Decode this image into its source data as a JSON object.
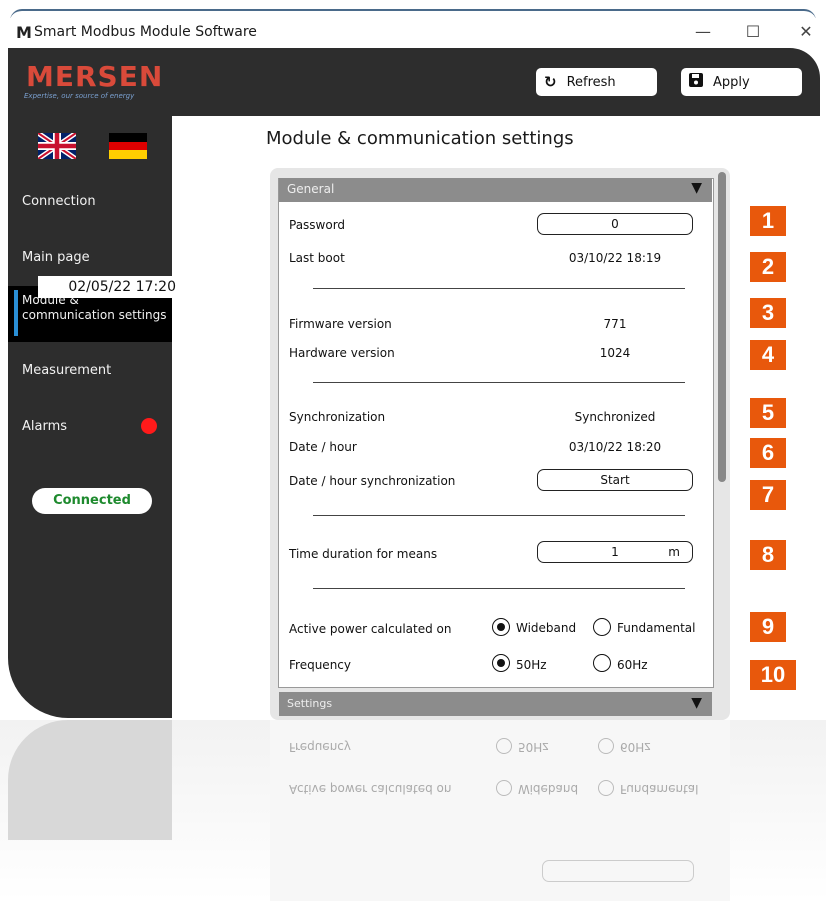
{
  "window": {
    "title": "Smart Modbus Module Software"
  },
  "brand": {
    "logo": "MERSEN",
    "tagline": "Expertise, our source of energy"
  },
  "toolbar": {
    "refresh_label": "Refresh",
    "apply_label": "Apply"
  },
  "sidebar": {
    "items": [
      {
        "label": "Connection"
      },
      {
        "label": "Main page"
      },
      {
        "label": "Module & communication settings"
      },
      {
        "label": "Measurement"
      },
      {
        "label": "Alarms"
      }
    ],
    "tooltip": "02/05/22 17:20",
    "status": "Connected",
    "alarm_color": "#ff1a1a"
  },
  "main": {
    "title": "Module & communication settings",
    "section_general": "General",
    "section_settings": "Settings",
    "rows": {
      "password_label": "Password",
      "password_value": "0",
      "last_boot_label": "Last boot",
      "last_boot_value": "03/10/22 18:19",
      "firmware_label": "Firmware version",
      "firmware_value": "771",
      "hardware_label": "Hardware version",
      "hardware_value": "1024",
      "sync_label": "Synchronization",
      "sync_value": "Synchronized",
      "datehour_label": "Date / hour",
      "datehour_value": "03/10/22 18:20",
      "datehour_sync_label": "Date / hour synchronization",
      "start_label": "Start",
      "means_label": "Time duration for means",
      "means_value": "1",
      "means_unit": "m",
      "power_label": "Active power calculated on",
      "power_opt1": "Wideband",
      "power_opt2": "Fundamental",
      "freq_label": "Frequency",
      "freq_opt1": "50Hz",
      "freq_opt2": "60Hz"
    },
    "selected": {
      "power": "Wideband",
      "frequency": "50Hz"
    }
  },
  "callouts": [
    "1",
    "2",
    "3",
    "4",
    "5",
    "6",
    "7",
    "8",
    "9",
    "10"
  ],
  "colors": {
    "accent": "#e8580c",
    "sidebar": "#2d2d2d",
    "active_bar": "#2a8fd6",
    "connected_text": "#1e8a2e"
  }
}
